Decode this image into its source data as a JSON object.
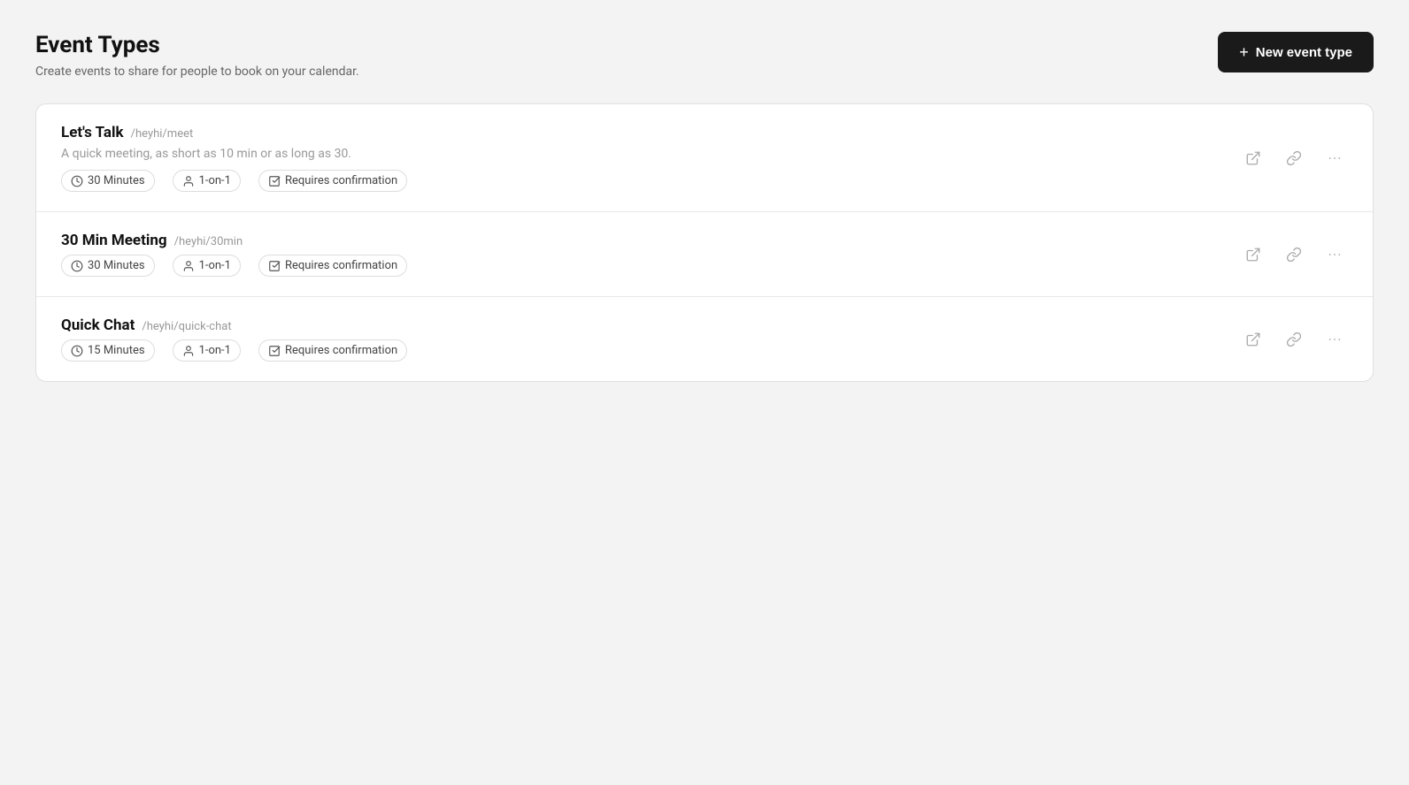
{
  "page": {
    "title": "Event Types",
    "subtitle": "Create events to share for people to book on your calendar."
  },
  "new_event_button": {
    "label": "New event type",
    "plus": "+"
  },
  "events": [
    {
      "id": "lets-talk",
      "name": "Let's Talk",
      "slug": "/heyhi/meet",
      "description": "A quick meeting, as short as 10 min or as long as 30.",
      "duration": "30 Minutes",
      "attendees": "1-on-1",
      "confirmation": "Requires confirmation"
    },
    {
      "id": "30-min-meeting",
      "name": "30 Min Meeting",
      "slug": "/heyhi/30min",
      "description": "",
      "duration": "30 Minutes",
      "attendees": "1-on-1",
      "confirmation": "Requires confirmation"
    },
    {
      "id": "quick-chat",
      "name": "Quick Chat",
      "slug": "/heyhi/quick-chat",
      "description": "",
      "duration": "15 Minutes",
      "attendees": "1-on-1",
      "confirmation": "Requires confirmation"
    }
  ]
}
